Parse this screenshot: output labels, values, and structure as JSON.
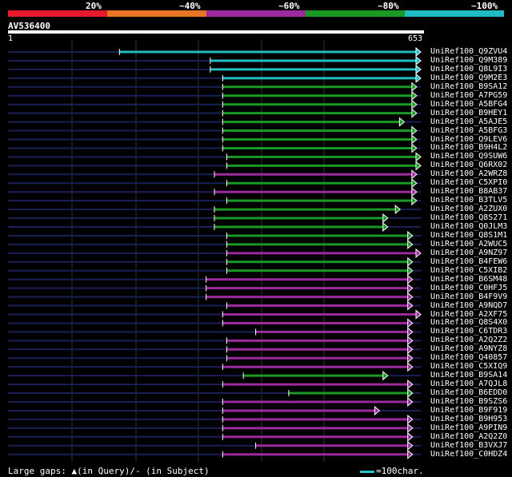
{
  "legend": {
    "segments": [
      {
        "label": "20%",
        "color": "#e8192c"
      },
      {
        "label": "~40%",
        "color": "#e87426"
      },
      {
        "label": "~60%",
        "color": "#9b2b9c"
      },
      {
        "label": "~80%",
        "color": "#1a9a25"
      },
      {
        "label": "~100%",
        "color": "#20bcc4"
      }
    ]
  },
  "query": {
    "id": "AV536400",
    "start": "1",
    "end": "653"
  },
  "hits": [
    {
      "label": "UniRef100_Q9ZVU4",
      "color": "#20bcc4",
      "start": 0.27,
      "end": 1.0
    },
    {
      "label": "UniRef100_Q9M389",
      "color": "#20bcc4",
      "start": 0.49,
      "end": 1.0
    },
    {
      "label": "UniRef100_Q8L9I3",
      "color": "#20bcc4",
      "start": 0.49,
      "end": 1.0
    },
    {
      "label": "UniRef100_Q9M2E3",
      "color": "#20bcc4",
      "start": 0.52,
      "end": 1.0
    },
    {
      "label": "UniRef100_B9SA12",
      "color": "#1a9a25",
      "start": 0.52,
      "end": 0.99
    },
    {
      "label": "UniRef100_A7PG59",
      "color": "#1a9a25",
      "start": 0.52,
      "end": 0.99
    },
    {
      "label": "UniRef100_A5BFG4",
      "color": "#1a9a25",
      "start": 0.52,
      "end": 0.99
    },
    {
      "label": "UniRef100_B9HEY1",
      "color": "#1a9a25",
      "start": 0.52,
      "end": 0.99
    },
    {
      "label": "UniRef100_A5AJE5",
      "color": "#1a9a25",
      "start": 0.52,
      "end": 0.96
    },
    {
      "label": "UniRef100_A5BFG3",
      "color": "#1a9a25",
      "start": 0.52,
      "end": 0.99
    },
    {
      "label": "UniRef100_Q9LEV6",
      "color": "#1a9a25",
      "start": 0.52,
      "end": 0.99
    },
    {
      "label": "UniRef100_B9H4L2",
      "color": "#1a9a25",
      "start": 0.52,
      "end": 0.99
    },
    {
      "label": "UniRef100_Q9SUW6",
      "color": "#1a9a25",
      "start": 0.53,
      "end": 1.0
    },
    {
      "label": "UniRef100_Q6RX02",
      "color": "#1a9a25",
      "start": 0.53,
      "end": 1.0
    },
    {
      "label": "UniRef100_A2WRZ8",
      "color": "#9b2b9c",
      "start": 0.5,
      "end": 0.99
    },
    {
      "label": "UniRef100_C5XPI0",
      "color": "#1a9a25",
      "start": 0.53,
      "end": 0.99
    },
    {
      "label": "UniRef100_B8AB37",
      "color": "#9b2b9c",
      "start": 0.5,
      "end": 0.99
    },
    {
      "label": "UniRef100_B3TLV5",
      "color": "#1a9a25",
      "start": 0.53,
      "end": 0.99
    },
    {
      "label": "UniRef100_A2ZUX0",
      "color": "#1a9a25",
      "start": 0.5,
      "end": 0.95
    },
    {
      "label": "UniRef100_Q8S271",
      "color": "#1a9a25",
      "start": 0.5,
      "end": 0.92
    },
    {
      "label": "UniRef100_Q0JLM3",
      "color": "#1a9a25",
      "start": 0.5,
      "end": 0.92
    },
    {
      "label": "UniRef100_Q8S1M1",
      "color": "#1a9a25",
      "start": 0.53,
      "end": 0.98
    },
    {
      "label": "UniRef100_A2WUC5",
      "color": "#1a9a25",
      "start": 0.53,
      "end": 0.98
    },
    {
      "label": "UniRef100_A9NZ97",
      "color": "#9b2b9c",
      "start": 0.53,
      "end": 1.0
    },
    {
      "label": "UniRef100_B4FEW6",
      "color": "#1a9a25",
      "start": 0.53,
      "end": 0.98
    },
    {
      "label": "UniRef100_C5XIB2",
      "color": "#1a9a25",
      "start": 0.53,
      "end": 0.98
    },
    {
      "label": "UniRef100_B6SM48",
      "color": "#9b2b9c",
      "start": 0.48,
      "end": 0.98
    },
    {
      "label": "UniRef100_C0HFJ5",
      "color": "#9b2b9c",
      "start": 0.48,
      "end": 0.98
    },
    {
      "label": "UniRef100_B4F9V9",
      "color": "#9b2b9c",
      "start": 0.48,
      "end": 0.98
    },
    {
      "label": "UniRef100_A9NQD7",
      "color": "#9b2b9c",
      "start": 0.53,
      "end": 0.98
    },
    {
      "label": "UniRef100_A2XF75",
      "color": "#9b2b9c",
      "start": 0.52,
      "end": 1.0
    },
    {
      "label": "UniRef100_Q8S4X0",
      "color": "#9b2b9c",
      "start": 0.52,
      "end": 0.98
    },
    {
      "label": "UniRef100_C6TDR3",
      "color": "#9b2b9c",
      "start": 0.6,
      "end": 0.98
    },
    {
      "label": "UniRef100_A2Q2Z2",
      "color": "#9b2b9c",
      "start": 0.53,
      "end": 0.98
    },
    {
      "label": "UniRef100_A9NYZ8",
      "color": "#9b2b9c",
      "start": 0.53,
      "end": 0.98
    },
    {
      "label": "UniRef100_Q40857",
      "color": "#9b2b9c",
      "start": 0.53,
      "end": 0.98
    },
    {
      "label": "UniRef100_C5XIQ9",
      "color": "#9b2b9c",
      "start": 0.52,
      "end": 0.98
    },
    {
      "label": "UniRef100_B9SA14",
      "color": "#1a9a25",
      "start": 0.57,
      "end": 0.92
    },
    {
      "label": "UniRef100_A7QJL8",
      "color": "#9b2b9c",
      "start": 0.52,
      "end": 0.98
    },
    {
      "label": "UniRef100_B6EDD0",
      "color": "#1a9a25",
      "start": 0.68,
      "end": 0.98
    },
    {
      "label": "UniRef100_B9SZS6",
      "color": "#9b2b9c",
      "start": 0.52,
      "end": 0.98
    },
    {
      "label": "UniRef100_B9F919",
      "color": "#9b2b9c",
      "start": 0.52,
      "end": 0.9
    },
    {
      "label": "UniRef100_B9H953",
      "color": "#9b2b9c",
      "start": 0.52,
      "end": 0.98
    },
    {
      "label": "UniRef100_A9PIN9",
      "color": "#9b2b9c",
      "start": 0.52,
      "end": 0.98
    },
    {
      "label": "UniRef100_A2Q2Z0",
      "color": "#9b2b9c",
      "start": 0.52,
      "end": 0.98
    },
    {
      "label": "UniRef100_B3VXJ7",
      "color": "#9b2b9c",
      "start": 0.6,
      "end": 0.98
    },
    {
      "label": "UniRef100_C0HDZ4",
      "color": "#9b2b9c",
      "start": 0.52,
      "end": 0.98
    }
  ],
  "footer": {
    "gaps_label": "Large gaps: ▲(in Query)/- (in Subject)",
    "scale_label": "=100char."
  }
}
